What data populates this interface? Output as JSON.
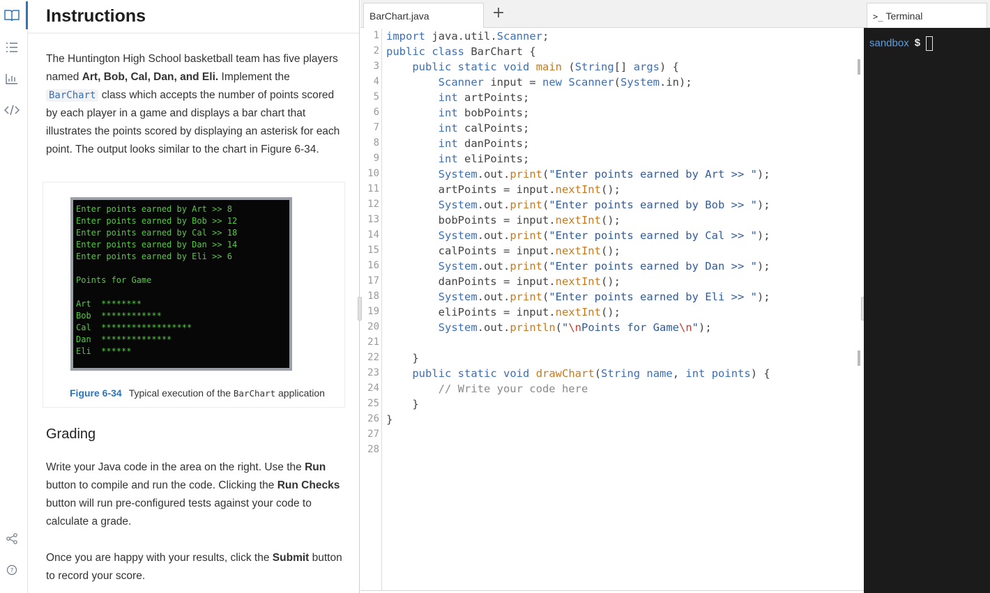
{
  "rail": {
    "icons": [
      "book-icon",
      "list-icon",
      "chart-icon",
      "code-icon",
      "share-icon",
      "help-icon"
    ]
  },
  "instructions": {
    "title": "Instructions",
    "para1_a": "The Huntington High School basketball team has five players named ",
    "para1_names": "Art, Bob, Cal, Dan, and Eli.",
    "para1_b": " Implement the ",
    "para1_code": "BarChart",
    "para1_c": " class which accepts the number of points scored by each player in a game and displays a bar chart that illustrates the points scored by displaying an asterisk for each point. The output looks similar to the chart in Figure 6-34.",
    "figure_terminal": "Enter points earned by Art >> 8\nEnter points earned by Bob >> 12\nEnter points earned by Cal >> 18\nEnter points earned by Dan >> 14\nEnter points earned by Eli >> 6\n\nPoints for Game\n\nArt  ********\nBob  ************\nCal  ******************\nDan  **************\nEli  ******",
    "figure_number": "Figure 6-34",
    "figure_caption_a": "Typical execution of the ",
    "figure_caption_code": "BarChart",
    "figure_caption_b": " application",
    "grading_title": "Grading",
    "grading_a": "Write your Java code in the area on the right. Use the ",
    "grading_run": "Run",
    "grading_b": " button to compile and run the code. Clicking the ",
    "grading_run_checks": "Run Checks",
    "grading_c": " button will run pre-configured tests against your code to calculate a grade.",
    "submit_a": "Once you are happy with your results, click the ",
    "submit_bold": "Submit",
    "submit_b": " button to record your score."
  },
  "editor": {
    "tab_label": "BarChart.java",
    "add_tab": "+",
    "line_numbers": [
      "1",
      "2",
      "3",
      "4",
      "5",
      "6",
      "7",
      "8",
      "9",
      "10",
      "11",
      "12",
      "13",
      "14",
      "15",
      "16",
      "17",
      "18",
      "19",
      "20",
      "21",
      "22",
      "23",
      "24",
      "25",
      "26",
      "27",
      "28"
    ],
    "lines": [
      "import java.util.Scanner;",
      "public class BarChart {",
      "    public static void main (String[] args) {",
      "        Scanner input = new Scanner(System.in);",
      "        int artPoints;",
      "        int bobPoints;",
      "        int calPoints;",
      "        int danPoints;",
      "        int eliPoints;",
      "        System.out.print(\"Enter points earned by Art >> \");",
      "        artPoints = input.nextInt();",
      "        System.out.print(\"Enter points earned by Bob >> \");",
      "        bobPoints = input.nextInt();",
      "        System.out.print(\"Enter points earned by Cal >> \");",
      "        calPoints = input.nextInt();",
      "        System.out.print(\"Enter points earned by Dan >> \");",
      "        danPoints = input.nextInt();",
      "        System.out.print(\"Enter points earned by Eli >> \");",
      "        eliPoints = input.nextInt();",
      "        System.out.println(\"\\nPoints for Game\\n\");",
      "",
      "    }",
      "    public static void drawChart(String name, int points) {",
      "        // Write your code here",
      "    }",
      "}",
      "",
      ""
    ]
  },
  "terminal": {
    "tab_glyph": ">_",
    "tab_label": "Terminal",
    "host": "sandbox",
    "dollar": "$"
  }
}
